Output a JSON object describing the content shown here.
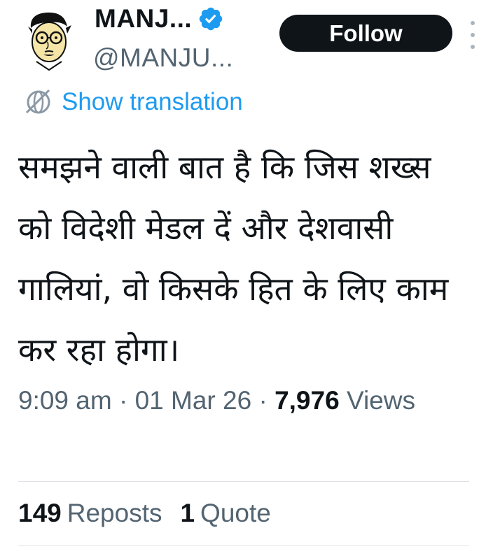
{
  "author": {
    "display_name": "MANJ...",
    "handle": "@MANJU...",
    "verified": true,
    "verified_color": "#1d9bf0"
  },
  "follow_button": {
    "label": "Follow"
  },
  "translation": {
    "label": "Show translation"
  },
  "tweet": {
    "text": "समझने वाली बात है कि जिस शख्स को विदेशी मेडल दें और देशवासी गालियां, वो किसके हित के लिए काम कर रहा होगा।"
  },
  "meta": {
    "time": "9:09 am",
    "separator": "·",
    "date": "01 Mar 26",
    "views_count": "7,976",
    "views_label": "Views"
  },
  "stats": {
    "reposts_count": "149",
    "reposts_label": "Reposts",
    "quotes_count": "1",
    "quotes_label": "Quote"
  },
  "colors": {
    "text": "#0f1419",
    "secondary": "#536471",
    "link": "#1d9bf0",
    "button_bg": "#0f1419"
  }
}
